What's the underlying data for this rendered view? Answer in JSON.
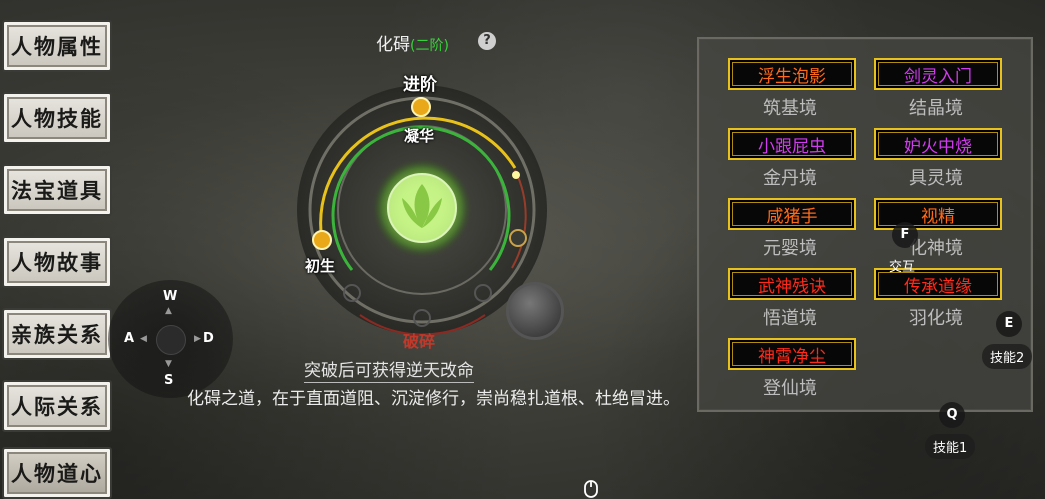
{
  "tabs": [
    {
      "label": "人物属性",
      "active": false
    },
    {
      "label": "人物技能",
      "active": false
    },
    {
      "label": "法宝道具",
      "active": false
    },
    {
      "label": "人物故事",
      "active": false
    },
    {
      "label": "亲族关系",
      "active": false
    },
    {
      "label": "人际关系",
      "active": false
    },
    {
      "label": "人物道心",
      "active": true
    }
  ],
  "joystick": {
    "up": "W",
    "left": "A",
    "right": "D",
    "down": "S"
  },
  "panel": {
    "title": "化碍",
    "stage": "(二阶)",
    "help": "?",
    "ring": {
      "top": "进阶",
      "inner": "凝华",
      "left": "初生",
      "bottom": "破碎"
    },
    "subtitle": "突破后可获得逆天改命",
    "description": "化碍之道，在于直面道阻、沉淀修行，崇尚稳扎道根、杜绝冒进。"
  },
  "realms": [
    {
      "tag": "浮生泡影",
      "tag_color": "#ff6a1a",
      "realm": "筑基境"
    },
    {
      "tag": "剑灵入门",
      "tag_color": "#d23cf0",
      "realm": "结晶境"
    },
    {
      "tag": "小跟屁虫",
      "tag_color": "#d23cf0",
      "realm": "金丹境"
    },
    {
      "tag": "妒火中烧",
      "tag_color": "#d23cf0",
      "realm": "具灵境"
    },
    {
      "tag": "咸猪手",
      "tag_color": "#ff6a1a",
      "realm": "元婴境"
    },
    {
      "tag": "视精",
      "tag_color": "#ff6a1a",
      "realm": "化神境"
    },
    {
      "tag": "武神残诀",
      "tag_color": "#ff2a1a",
      "realm": "悟道境"
    },
    {
      "tag": "传承道缘",
      "tag_color": "#ff2a1a",
      "realm": "羽化境"
    },
    {
      "tag": "神霄净尘",
      "tag_color": "#ff2a1a",
      "realm": "登仙境"
    }
  ],
  "controls": {
    "interact_key": "F",
    "interact_label": "交互",
    "skill2_key": "E",
    "skill2_label": "技能2",
    "skill1_key": "Q",
    "skill1_label": "技能1"
  },
  "colors": {
    "gold": "#e8c21a",
    "green": "#3bb43b",
    "glow": "#b6f06a",
    "break_red": "#c0392b"
  }
}
